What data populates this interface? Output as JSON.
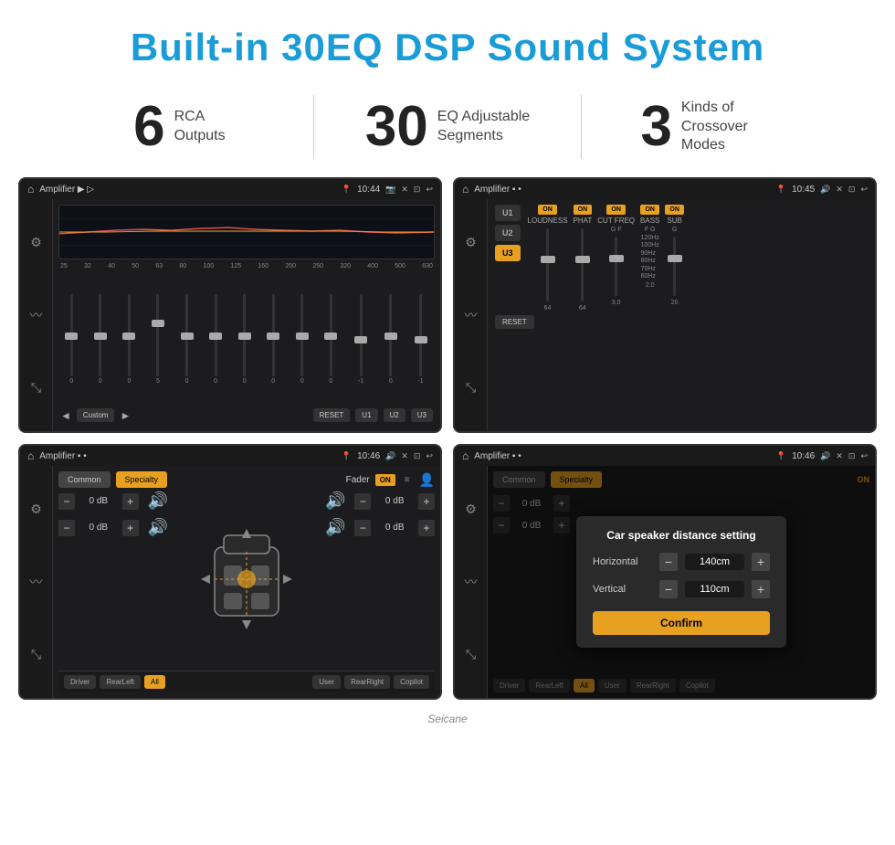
{
  "header": {
    "title": "Built-in 30EQ DSP Sound System"
  },
  "stats": [
    {
      "number": "6",
      "label": "RCA\nOutputs"
    },
    {
      "number": "30",
      "label": "EQ Adjustable\nSegments"
    },
    {
      "number": "3",
      "label": "Kinds of\nCrossover Modes"
    }
  ],
  "screens": {
    "eq": {
      "topbar": {
        "title": "Amplifier",
        "time": "10:44"
      },
      "freq_labels": [
        "25",
        "32",
        "40",
        "50",
        "63",
        "80",
        "100",
        "125",
        "160",
        "200",
        "250",
        "320",
        "400",
        "500",
        "630"
      ],
      "slider_values": [
        "0",
        "0",
        "0",
        "5",
        "0",
        "0",
        "0",
        "0",
        "0",
        "0",
        "-1",
        "0",
        "-1"
      ],
      "buttons": [
        "Custom",
        "RESET",
        "U1",
        "U2",
        "U3"
      ]
    },
    "amp": {
      "topbar": {
        "title": "Amplifier",
        "time": "10:45"
      },
      "u_buttons": [
        "U1",
        "U2",
        "U3"
      ],
      "channels": [
        "LOUDNESS",
        "PHAT",
        "CUT FREQ",
        "BASS",
        "SUB"
      ],
      "reset_btn": "RESET"
    },
    "fader": {
      "topbar": {
        "title": "Amplifier",
        "time": "10:46"
      },
      "tabs": [
        "Common",
        "Specialty"
      ],
      "fader_label": "Fader",
      "on_badge": "ON",
      "db_values": [
        "0 dB",
        "0 dB",
        "0 dB",
        "0 dB"
      ],
      "pos_buttons": [
        "Driver",
        "RearLeft",
        "All",
        "User",
        "RearRight",
        "Copilot"
      ]
    },
    "distance": {
      "topbar": {
        "title": "Amplifier",
        "time": "10:46"
      },
      "tabs": [
        "Common",
        "Specialty"
      ],
      "dialog": {
        "title": "Car speaker distance setting",
        "rows": [
          {
            "label": "Horizontal",
            "value": "140cm"
          },
          {
            "label": "Vertical",
            "value": "110cm"
          }
        ],
        "confirm_btn": "Confirm"
      }
    }
  },
  "watermark": "Seicane"
}
